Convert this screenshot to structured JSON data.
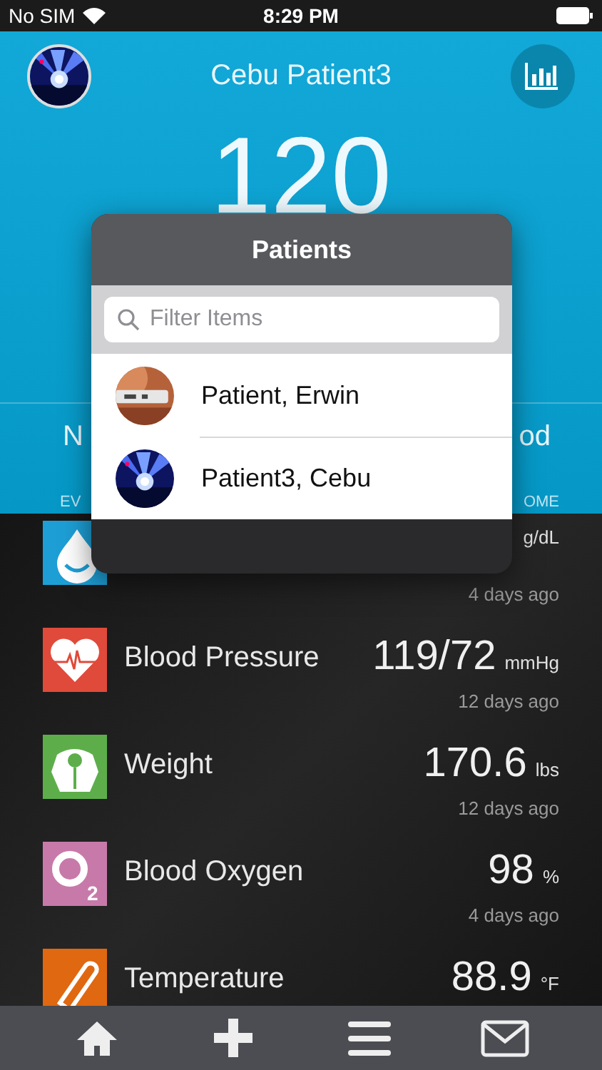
{
  "status_bar": {
    "carrier": "No SIM",
    "time": "8:29 PM"
  },
  "header": {
    "title": "Cebu Patient3",
    "reading": "120",
    "left_label": "N",
    "right_label": "od",
    "left_caption": "EV",
    "right_caption": "OME"
  },
  "readings": [
    {
      "kind": "glucose",
      "unit": "g/dL",
      "ago": "4 days ago"
    },
    {
      "kind": "pressure",
      "name": "Blood Pressure",
      "value": "119/72",
      "unit": "mmHg",
      "ago": "12 days ago"
    },
    {
      "kind": "weight",
      "name": "Weight",
      "value": "170.6",
      "unit": "lbs",
      "ago": "12 days ago"
    },
    {
      "kind": "oxygen",
      "name": "Blood Oxygen",
      "icon_label": "2",
      "value": "98",
      "unit": "%",
      "ago": "4 days ago"
    },
    {
      "kind": "temperature",
      "name": "Temperature",
      "value": "88.9",
      "unit": "°F"
    }
  ],
  "popover": {
    "title": "Patients",
    "search": {
      "placeholder": "Filter Items"
    },
    "patients": [
      {
        "name": "Patient, Erwin"
      },
      {
        "name": "Patient3, Cebu"
      }
    ]
  }
}
